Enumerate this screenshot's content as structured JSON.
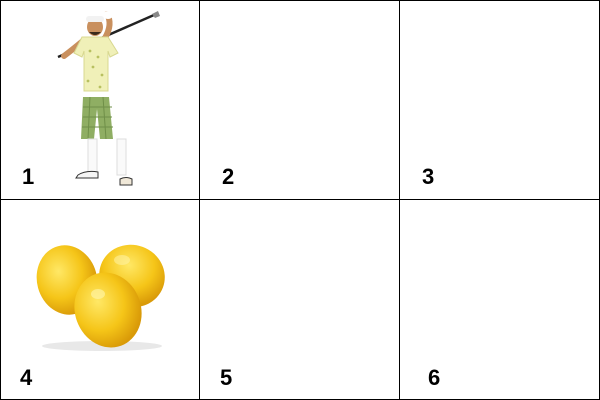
{
  "grid": {
    "cells": [
      {
        "number": "1",
        "image": "golfer-picture"
      },
      {
        "number": "2",
        "image": ""
      },
      {
        "number": "3",
        "image": ""
      },
      {
        "number": "4",
        "image": "lemons-picture"
      },
      {
        "number": "5",
        "image": ""
      },
      {
        "number": "6",
        "image": ""
      }
    ]
  },
  "colors": {
    "line": "#000000",
    "background": "#ffffff",
    "lemon": "#f5c518"
  }
}
